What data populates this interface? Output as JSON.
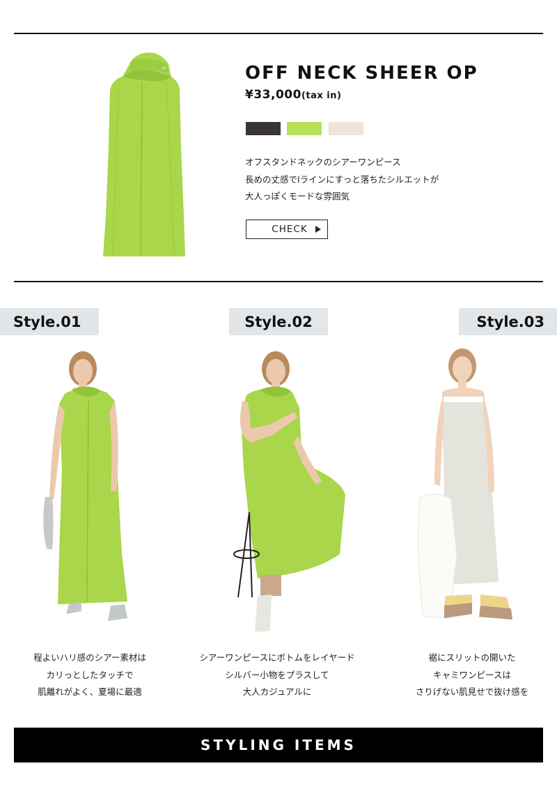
{
  "product": {
    "name": "OFF NECK SHEER OP",
    "price": "¥33,000",
    "tax_note": "(tax in)",
    "color_swatches": [
      {
        "name": "black",
        "color": "#3a3533"
      },
      {
        "name": "lime",
        "color": "#b7e05a"
      },
      {
        "name": "ivory",
        "color": "#efe4da"
      }
    ],
    "description": [
      "オフスタンドネックのシアーワンピース",
      "長めの丈感でIラインにすっと落ちたシルエットが",
      "大人っぽくモードな雰囲気"
    ],
    "check_label": "CHECK"
  },
  "styles": [
    {
      "label": "Style.01",
      "caption": [
        "程よいハリ感のシアー素材は",
        "カリっとしたタッチで",
        "肌離れがよく、夏場に最適"
      ]
    },
    {
      "label": "Style.02",
      "caption": [
        "シアーワンピースにボトムをレイヤード",
        "シルバー小物をプラスして",
        "大人カジュアルに"
      ]
    },
    {
      "label": "Style.03",
      "caption": [
        "裾にスリットの開いた",
        "キャミワンピースは",
        "さりげない肌見せで抜け感を"
      ]
    }
  ],
  "styling_items_label": "STYLING ITEMS",
  "colors": {
    "dress_green": "#a9d64a",
    "dress_ivory": "#e4e4dc",
    "tag_bg": "#e3e6e9",
    "bar_bg": "#000000"
  }
}
